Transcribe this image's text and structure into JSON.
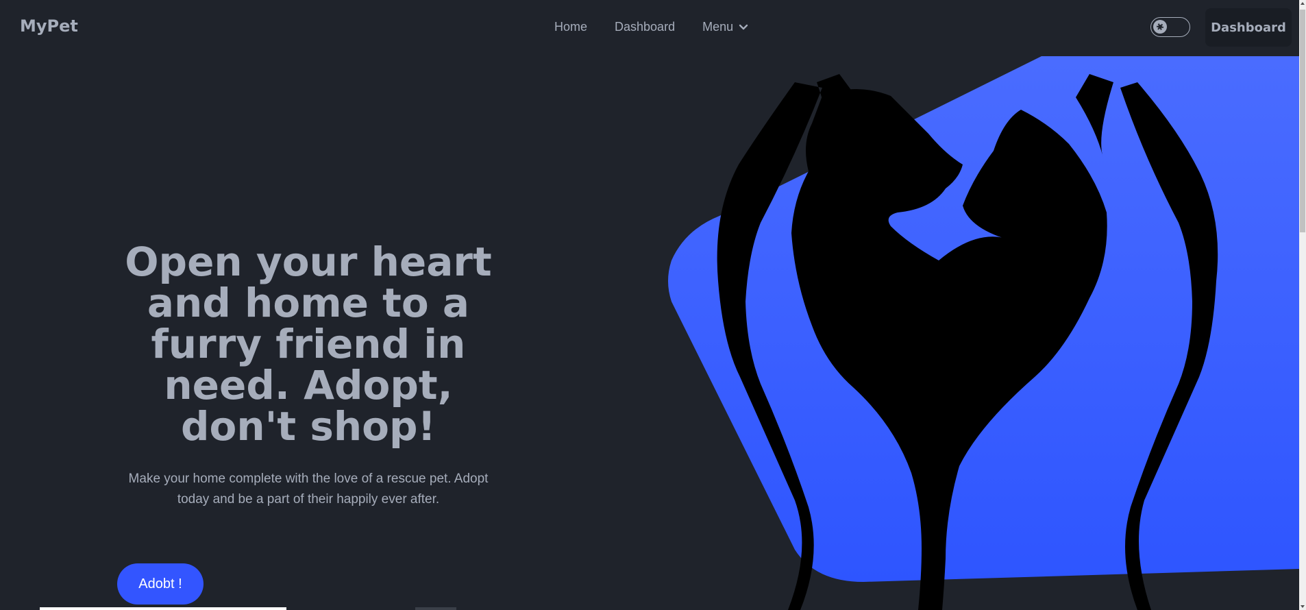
{
  "navbar": {
    "brand": "MyPet",
    "links": [
      "Home",
      "Dashboard"
    ],
    "menu_label": "Menu",
    "dashboard_button": "Dashboard"
  },
  "hero": {
    "title": "Open your heart and home to a furry friend in need. Adopt, don't shop!",
    "subtitle": "Make your home complete with the love of a rescue pet. Adopt today and be a part of their happily ever after.",
    "cta_label": "Adobt !"
  },
  "colors": {
    "background": "#1f232b",
    "accent": "#3355ff",
    "text": "#a6adbb"
  },
  "icons": {
    "theme_toggle": "sun-icon",
    "menu_chevron": "chevron-down-icon"
  }
}
